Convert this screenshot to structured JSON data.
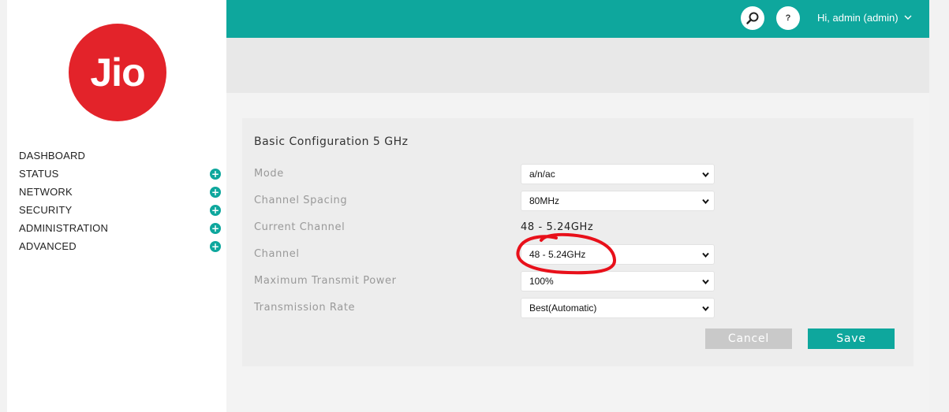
{
  "brand": {
    "logo_text": "Jio",
    "logo_color": "#e3232a",
    "accent_color": "#0ea79d"
  },
  "sidebar": {
    "items": [
      {
        "label": "DASHBOARD",
        "expandable": false
      },
      {
        "label": "STATUS",
        "expandable": true
      },
      {
        "label": "NETWORK",
        "expandable": true
      },
      {
        "label": "SECURITY",
        "expandable": true
      },
      {
        "label": "ADMINISTRATION",
        "expandable": true
      },
      {
        "label": "ADVANCED",
        "expandable": true
      }
    ],
    "expand_symbol": "+"
  },
  "header": {
    "search_icon": "search-icon",
    "help_label": "?",
    "user_label": "Hi, admin (admin)",
    "user_icon": "chevron-down-icon"
  },
  "panel": {
    "title": "Basic Configuration 5 GHz",
    "fields": {
      "mode": {
        "label": "Mode",
        "value": "a/n/ac"
      },
      "channel_spacing": {
        "label": "Channel Spacing",
        "value": "80MHz"
      },
      "current_channel": {
        "label": "Current Channel",
        "value": "48 - 5.24GHz"
      },
      "channel": {
        "label": "Channel",
        "value": "48 - 5.24GHz"
      },
      "max_transmit_power": {
        "label": "Maximum Transmit Power",
        "value": "100%"
      },
      "transmission_rate": {
        "label": "Transmission Rate",
        "value": "Best(Automatic)"
      }
    },
    "cancel_label": "Cancel",
    "save_label": "Save"
  },
  "annotation": {
    "color": "#e8101a"
  }
}
